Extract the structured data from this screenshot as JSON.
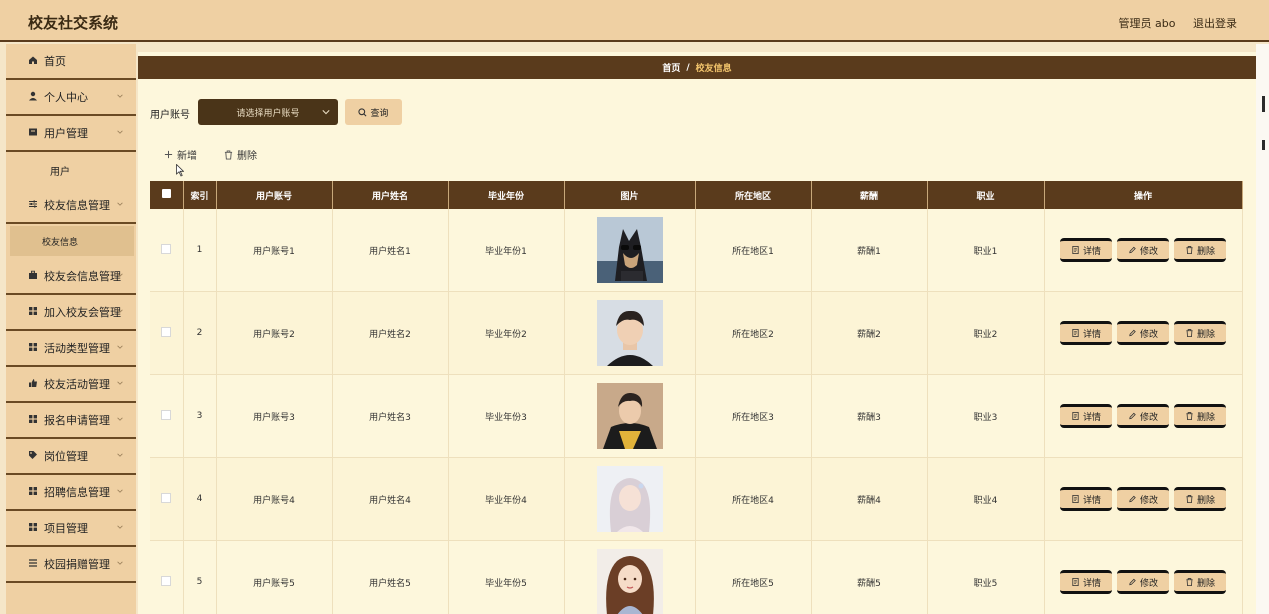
{
  "header": {
    "title": "校友社交系统",
    "user": "管理员 abo",
    "logout": "退出登录"
  },
  "sidebar": {
    "items": [
      {
        "label": "首页",
        "icon": "home-icon"
      },
      {
        "label": "个人中心",
        "icon": "user-icon"
      },
      {
        "label": "用户管理",
        "icon": "box-icon"
      },
      {
        "label": "用户",
        "sub": true
      },
      {
        "label": "校友信息管理",
        "icon": "sliders-icon"
      },
      {
        "label": "校友信息",
        "sub": true,
        "active": true
      },
      {
        "label": "校友会信息管理",
        "icon": "briefcase-icon"
      },
      {
        "label": "加入校友会管理",
        "icon": "grid-icon"
      },
      {
        "label": "活动类型管理",
        "icon": "grid-icon"
      },
      {
        "label": "校友活动管理",
        "icon": "thumb-icon"
      },
      {
        "label": "报名申请管理",
        "icon": "grid-icon"
      },
      {
        "label": "岗位管理",
        "icon": "tag-icon"
      },
      {
        "label": "招聘信息管理",
        "icon": "grid-icon"
      },
      {
        "label": "项目管理",
        "icon": "grid-icon"
      },
      {
        "label": "校园捐赠管理",
        "icon": "list-icon"
      }
    ]
  },
  "breadcrumb": {
    "home": "首页",
    "sep": "/",
    "current": "校友信息"
  },
  "search": {
    "label": "用户账号",
    "placeholder": "请选择用户账号",
    "button": "查询"
  },
  "toolbar": {
    "add": "新增",
    "delete": "删除"
  },
  "table": {
    "columns": [
      "索引",
      "用户账号",
      "用户姓名",
      "毕业年份",
      "图片",
      "所在地区",
      "薪酬",
      "职业",
      "操作"
    ],
    "rows": [
      {
        "index": "1",
        "account": "用户账号1",
        "name": "用户姓名1",
        "year": "毕业年份1",
        "photo": "dog-with-sunglasses",
        "region": "所在地区1",
        "salary": "薪酬1",
        "job": "职业1"
      },
      {
        "index": "2",
        "account": "用户账号2",
        "name": "用户姓名2",
        "year": "毕业年份2",
        "photo": "young-man-black-shirt",
        "region": "所在地区2",
        "salary": "薪酬2",
        "job": "职业2"
      },
      {
        "index": "3",
        "account": "用户账号3",
        "name": "用户姓名3",
        "year": "毕业年份3",
        "photo": "young-man-yellow-jacket",
        "region": "所在地区3",
        "salary": "薪酬3",
        "job": "职业3"
      },
      {
        "index": "4",
        "account": "用户账号4",
        "name": "用户姓名4",
        "year": "毕业年份4",
        "photo": "girl-light-hair",
        "region": "所在地区4",
        "salary": "薪酬4",
        "job": "职业4"
      },
      {
        "index": "5",
        "account": "用户账号5",
        "name": "用户姓名5",
        "year": "毕业年份5",
        "photo": "illustrated-woman",
        "region": "所在地区5",
        "salary": "薪酬5",
        "job": "职业5"
      }
    ],
    "actions": {
      "detail": "详情",
      "edit": "修改",
      "delete": "删除"
    }
  },
  "colors": {
    "accent": "#5a3b1c",
    "panel": "#efd0a3",
    "content": "#fdf7dc",
    "highlight": "#f1c36b"
  }
}
